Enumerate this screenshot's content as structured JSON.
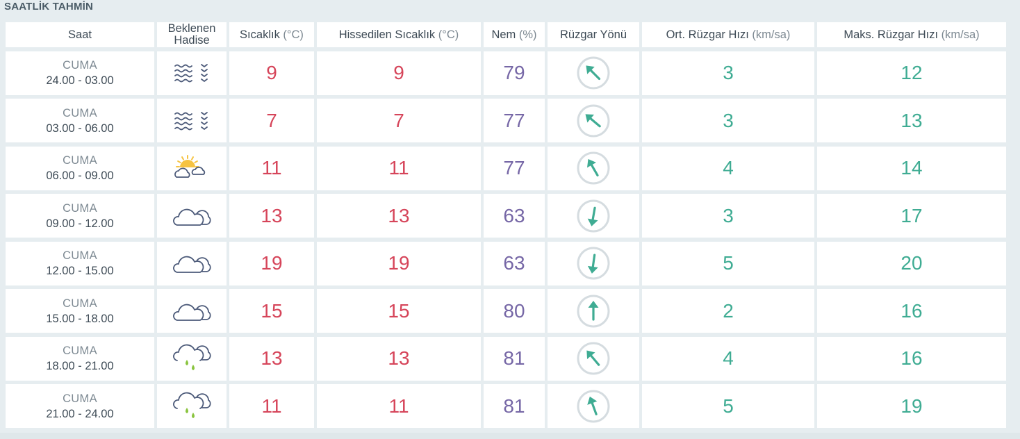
{
  "title": "SAATLİK TAHMİN",
  "headers": {
    "time": "Saat",
    "event_line1": "Beklenen",
    "event_line2": "Hadise",
    "temp": "Sıcaklık",
    "temp_unit": "(°C)",
    "feels": "Hissedilen Sıcaklık",
    "feels_unit": "(°C)",
    "humidity": "Nem",
    "humidity_unit": "(%)",
    "wind_dir": "Rüzgar Yönü",
    "avg_wind": "Ort. Rüzgar Hızı",
    "avg_wind_unit": "(km/sa)",
    "max_wind": "Maks. Rüzgar Hızı",
    "max_wind_unit": "(km/sa)"
  },
  "colors": {
    "temperature": "#d6455a",
    "humidity": "#7667a6",
    "wind_speed": "#3fac93",
    "wind_arrow": "#3fac93",
    "icon_stroke": "#4c5a79",
    "sun": "#f6c342",
    "rain_drop": "#8ac43f"
  },
  "rows": [
    {
      "day": "CUMA",
      "range": "24.00 - 03.00",
      "icon": "fog-icon",
      "temp": "9",
      "feels": "9",
      "humidity": "79",
      "wind_dir_deg": 315,
      "avg": "3",
      "max": "12"
    },
    {
      "day": "CUMA",
      "range": "03.00 - 06.00",
      "icon": "fog-icon",
      "temp": "7",
      "feels": "7",
      "humidity": "77",
      "wind_dir_deg": 310,
      "avg": "3",
      "max": "13"
    },
    {
      "day": "CUMA",
      "range": "06.00 - 09.00",
      "icon": "partly-cloudy-icon",
      "temp": "11",
      "feels": "11",
      "humidity": "77",
      "wind_dir_deg": 330,
      "avg": "4",
      "max": "14"
    },
    {
      "day": "CUMA",
      "range": "09.00 - 12.00",
      "icon": "cloudy-icon",
      "temp": "13",
      "feels": "13",
      "humidity": "63",
      "wind_dir_deg": 190,
      "avg": "3",
      "max": "17"
    },
    {
      "day": "CUMA",
      "range": "12.00 - 15.00",
      "icon": "cloudy-icon",
      "temp": "19",
      "feels": "19",
      "humidity": "63",
      "wind_dir_deg": 188,
      "avg": "5",
      "max": "20"
    },
    {
      "day": "CUMA",
      "range": "15.00 - 18.00",
      "icon": "cloudy-icon",
      "temp": "15",
      "feels": "15",
      "humidity": "80",
      "wind_dir_deg": 0,
      "avg": "2",
      "max": "16"
    },
    {
      "day": "CUMA",
      "range": "18.00 - 21.00",
      "icon": "rain-icon",
      "temp": "13",
      "feels": "13",
      "humidity": "81",
      "wind_dir_deg": 320,
      "avg": "4",
      "max": "16"
    },
    {
      "day": "CUMA",
      "range": "21.00 - 24.00",
      "icon": "rain-icon",
      "temp": "11",
      "feels": "11",
      "humidity": "81",
      "wind_dir_deg": 340,
      "avg": "5",
      "max": "19"
    }
  ]
}
